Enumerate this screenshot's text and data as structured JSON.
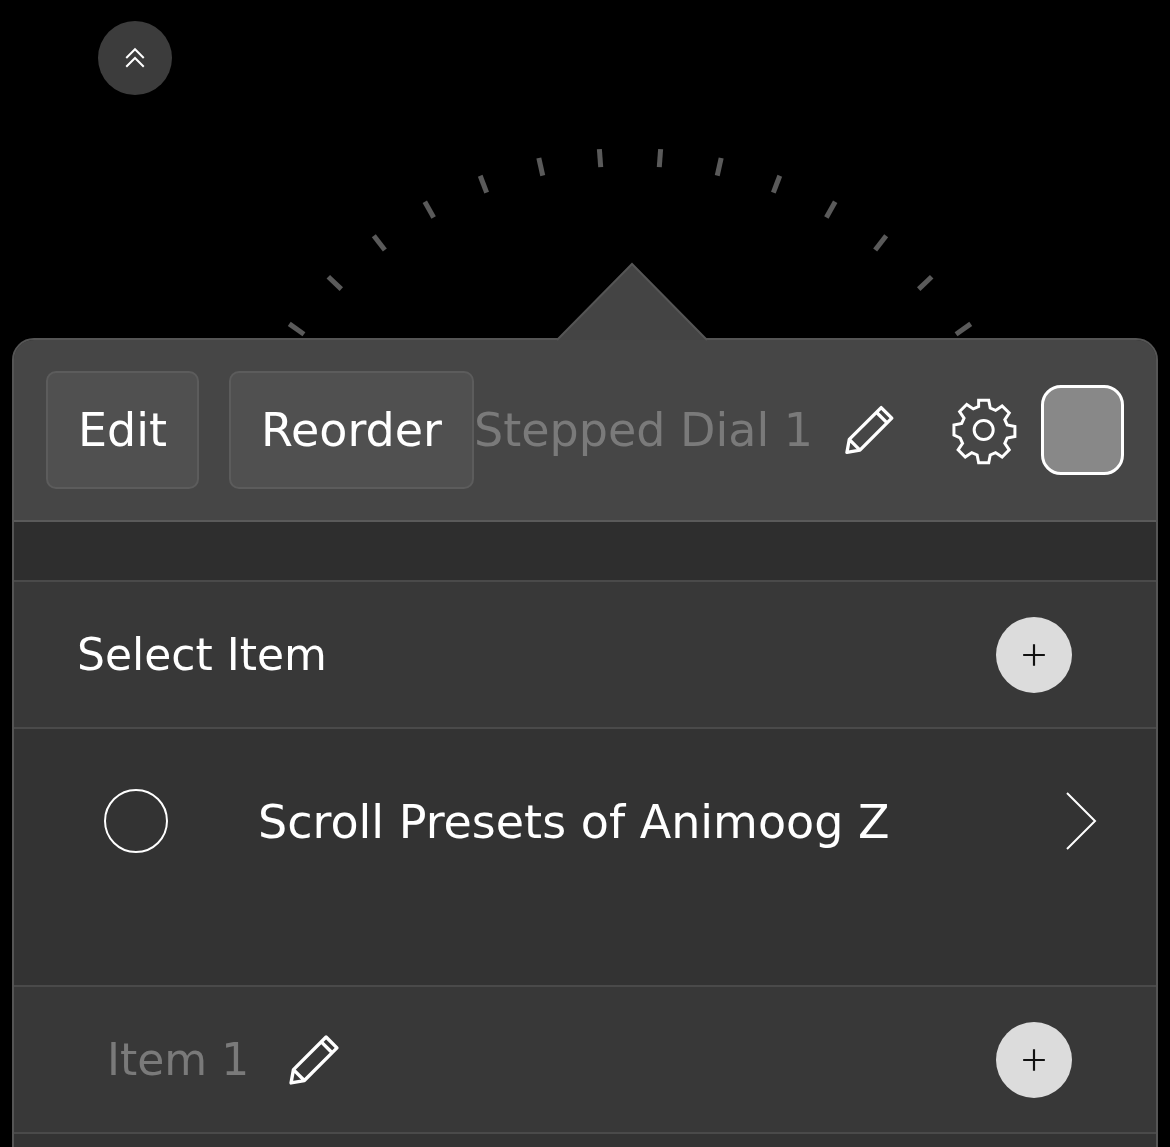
{
  "header": {
    "buttons": [
      "Edit",
      "Reorder"
    ],
    "title": "Stepped Dial 1"
  },
  "select_section": {
    "title": "Select Item"
  },
  "items": [
    {
      "label": "Scroll Presets of Animoog Z",
      "selected": false
    }
  ],
  "item_group": {
    "label": "Item 1"
  }
}
